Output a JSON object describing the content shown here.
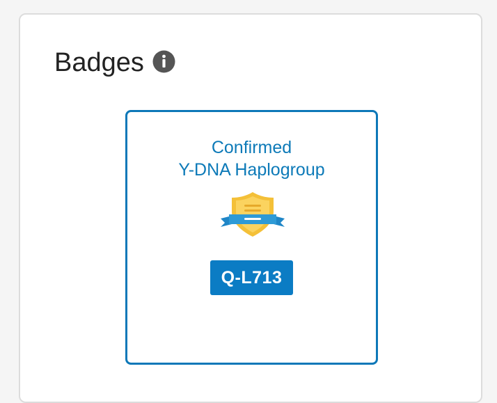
{
  "badges_section": {
    "heading": "Badges",
    "info_icon": "info-icon",
    "badge": {
      "title_line1": "Confirmed",
      "title_line2": "Y-DNA Haplogroup",
      "icon": "shield-ribbon-icon",
      "value": "Q-L713"
    }
  },
  "colors": {
    "accent": "#0d78b8",
    "pill_bg": "#0b7cc4",
    "shield_gold": "#f7c948",
    "ribbon_blue": "#2e9ad6"
  }
}
